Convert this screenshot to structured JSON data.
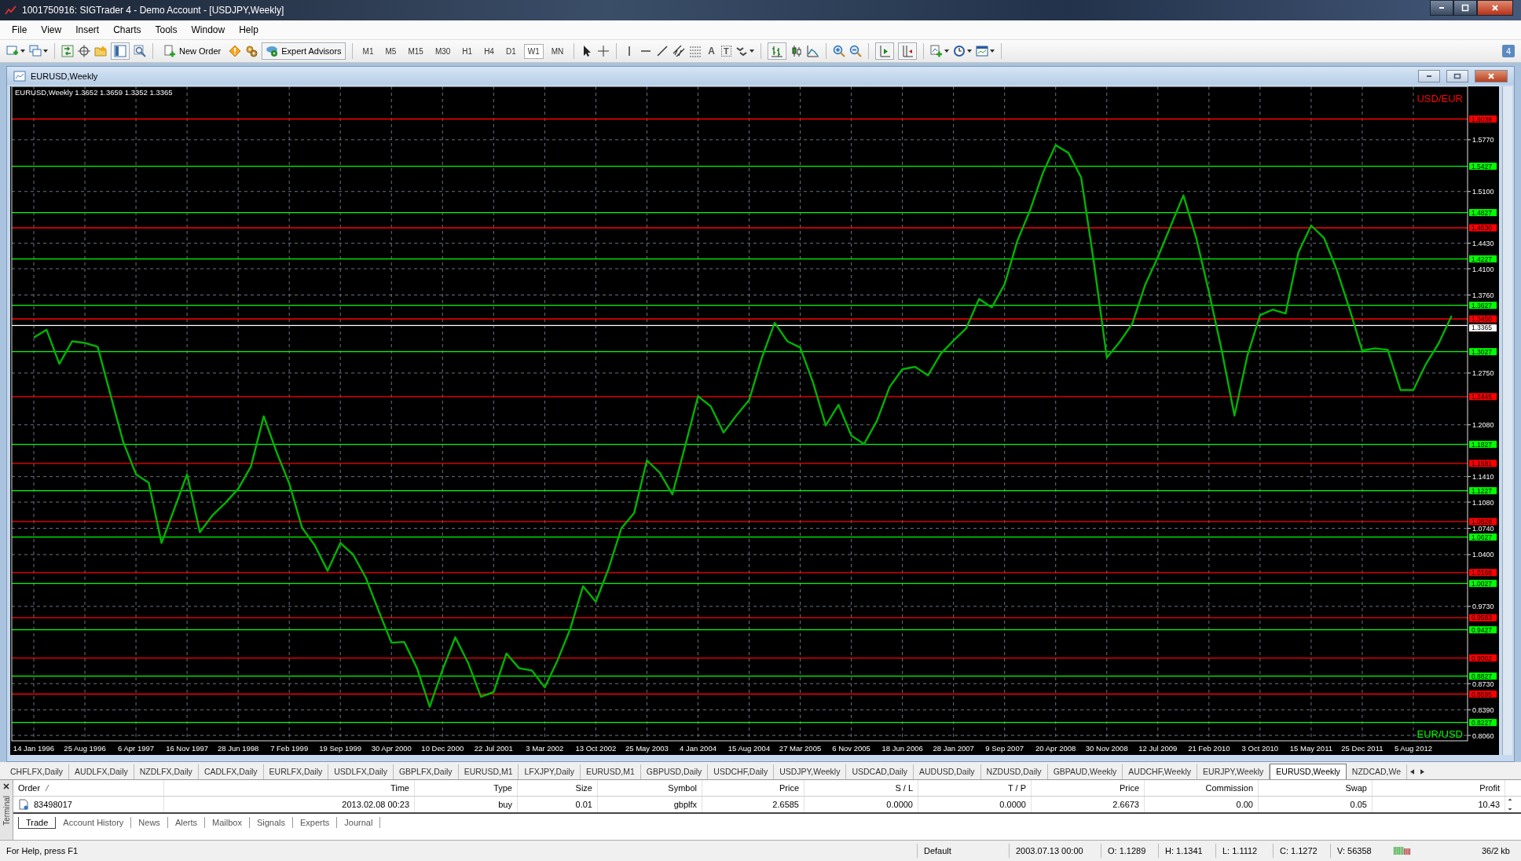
{
  "window": {
    "title": "1001750916: SIGTrader 4 - Demo Account - [USDJPY,Weekly]"
  },
  "menu": [
    "File",
    "View",
    "Insert",
    "Charts",
    "Tools",
    "Window",
    "Help"
  ],
  "toolbar": {
    "buttons": [
      {
        "label": "New Order",
        "pressed": false
      },
      {
        "label": "Expert Advisors",
        "pressed": true
      }
    ],
    "timeframes": [
      {
        "label": "M1",
        "selected": false
      },
      {
        "label": "M5",
        "selected": false
      },
      {
        "label": "M15",
        "selected": false
      },
      {
        "label": "M30",
        "selected": false
      },
      {
        "label": "H1",
        "selected": false
      },
      {
        "label": "H4",
        "selected": false
      },
      {
        "label": "D1",
        "selected": false
      },
      {
        "label": "W1",
        "selected": true
      },
      {
        "label": "MN",
        "selected": false
      }
    ],
    "text_tools": [
      "A",
      "T"
    ],
    "messages_badge": "4"
  },
  "chart_window": {
    "title": "EURUSD,Weekly",
    "chart_data": {
      "type": "line",
      "title": "EURUSD,Weekly  1.3652 1.3659 1.3352 1.3365",
      "categories": [
        "14 Jan 1996",
        null,
        null,
        null,
        "25 Aug 1996",
        null,
        null,
        null,
        "6 Apr 1997",
        null,
        null,
        null,
        "16 Nov 1997",
        null,
        null,
        null,
        "28 Jun 1998",
        null,
        null,
        null,
        "7 Feb 1999",
        null,
        null,
        null,
        "19 Sep 1999",
        null,
        null,
        null,
        "30 Apr 2000",
        null,
        null,
        null,
        "10 Dec 2000",
        null,
        null,
        null,
        "22 Jul 2001",
        null,
        null,
        null,
        "3 Mar 2002",
        null,
        null,
        null,
        "13 Oct 2002",
        null,
        null,
        null,
        "25 May 2003",
        null,
        null,
        null,
        "4 Jan 2004",
        null,
        null,
        null,
        "15 Aug 2004",
        null,
        null,
        null,
        "27 Mar 2005",
        null,
        null,
        null,
        "6 Nov 2005",
        null,
        null,
        null,
        "18 Jun 2006",
        null,
        null,
        null,
        "28 Jan 2007",
        null,
        null,
        null,
        "9 Sep 2007",
        null,
        null,
        null,
        "20 Apr 2008",
        null,
        null,
        null,
        "30 Nov 2008",
        null,
        null,
        null,
        "12 Jul 2009",
        null,
        null,
        null,
        "21 Feb 2010",
        null,
        null,
        null,
        "3 Oct 2010",
        null,
        null,
        null,
        "15 May 2011",
        null,
        null,
        null,
        "25 Dec 2011",
        null,
        null,
        null,
        "5 Aug 2012",
        null,
        null,
        null
      ],
      "series": [
        {
          "color": "#00b400",
          "values": [
            1.321,
            1.331,
            1.287,
            1.316,
            1.314,
            1.309,
            1.247,
            1.186,
            1.144,
            1.133,
            1.055,
            1.099,
            1.144,
            1.069,
            1.091,
            1.107,
            1.125,
            1.154,
            1.219,
            1.173,
            1.132,
            1.075,
            1.052,
            1.019,
            1.055,
            1.04,
            1.01,
            0.967,
            0.926,
            0.927,
            0.893,
            0.843,
            0.891,
            0.933,
            0.9,
            0.856,
            0.862,
            0.912,
            0.893,
            0.89,
            0.868,
            0.903,
            0.944,
            0.999,
            0.979,
            1.022,
            1.074,
            1.094,
            1.162,
            1.146,
            1.118,
            1.181,
            1.245,
            1.232,
            1.198,
            1.22,
            1.24,
            1.295,
            1.34,
            1.316,
            1.308,
            1.263,
            1.207,
            1.234,
            1.194,
            1.183,
            1.213,
            1.257,
            1.28,
            1.283,
            1.272,
            1.3,
            1.317,
            1.333,
            1.371,
            1.36,
            1.39,
            1.446,
            1.486,
            1.534,
            1.57,
            1.56,
            1.528,
            1.417,
            1.295,
            1.315,
            1.339,
            1.389,
            1.425,
            1.465,
            1.505,
            1.45,
            1.38,
            1.304,
            1.22,
            1.297,
            1.35,
            1.357,
            1.352,
            1.431,
            1.466,
            1.45,
            1.409,
            1.358,
            1.304,
            1.307,
            1.305,
            1.253,
            1.253,
            1.287,
            1.314,
            1.349
          ]
        }
      ],
      "ylim": [
        0.799,
        1.646
      ],
      "grid": true,
      "yticks": [
        {
          "value": 1.577,
          "label": "1.5770"
        },
        {
          "value": 1.51,
          "label": "1.5100"
        },
        {
          "value": 1.443,
          "label": "1.4430"
        },
        {
          "value": 1.41,
          "label": "1.4100"
        },
        {
          "value": 1.376,
          "label": "1.3760"
        },
        {
          "value": 1.275,
          "label": "1.2750"
        },
        {
          "value": 1.208,
          "label": "1.2080"
        },
        {
          "value": 1.141,
          "label": "1.1410"
        },
        {
          "value": 1.108,
          "label": "1.1080"
        },
        {
          "value": 1.074,
          "label": "1.0740"
        },
        {
          "value": 1.04,
          "label": "1.0400"
        },
        {
          "value": 0.973,
          "label": "0.9730"
        },
        {
          "value": 0.873,
          "label": "0.8730"
        },
        {
          "value": 0.839,
          "label": "0.8390"
        },
        {
          "value": 0.806,
          "label": "0.8060"
        }
      ],
      "ref_lines": [
        {
          "axis": "y",
          "value": 1.6038,
          "label": "1.6038",
          "color": "#ff0000"
        },
        {
          "axis": "y",
          "value": 1.5427,
          "label": "1.5427",
          "color": "#00ff00"
        },
        {
          "axis": "y",
          "value": 1.4827,
          "label": "1.4827",
          "color": "#00ff00"
        },
        {
          "axis": "y",
          "value": 1.463,
          "label": "1.4630",
          "color": "#ff0000"
        },
        {
          "axis": "y",
          "value": 1.4227,
          "label": "1.4227",
          "color": "#00ff00"
        },
        {
          "axis": "y",
          "value": 1.3627,
          "label": "1.3627",
          "color": "#00ff00"
        },
        {
          "axis": "y",
          "value": 1.345,
          "label": "1.3450",
          "color": "#ff0000"
        },
        {
          "axis": "y",
          "value": 1.3365,
          "label": "1.3365",
          "color": "#ffffff"
        },
        {
          "axis": "y",
          "value": 1.3027,
          "label": "1.3027",
          "color": "#00ff00"
        },
        {
          "axis": "y",
          "value": 1.2445,
          "label": "1.2445",
          "color": "#ff0000"
        },
        {
          "axis": "y",
          "value": 1.1827,
          "label": "1.1827",
          "color": "#00ff00"
        },
        {
          "axis": "y",
          "value": 1.1581,
          "label": "1.1581",
          "color": "#ff0000"
        },
        {
          "axis": "y",
          "value": 1.1227,
          "label": "1.1227",
          "color": "#00ff00"
        },
        {
          "axis": "y",
          "value": 1.0828,
          "label": "1.0828",
          "color": "#ff0000"
        },
        {
          "axis": "y",
          "value": 1.0627,
          "label": "1.0627",
          "color": "#00ff00"
        },
        {
          "axis": "y",
          "value": 1.0168,
          "label": "1.0168",
          "color": "#ff0000"
        },
        {
          "axis": "y",
          "value": 1.0027,
          "label": "1.0027",
          "color": "#00ff00"
        },
        {
          "axis": "y",
          "value": 0.9583,
          "label": "0.9583",
          "color": "#ff0000"
        },
        {
          "axis": "y",
          "value": 0.9427,
          "label": "0.9427",
          "color": "#00ff00"
        },
        {
          "axis": "y",
          "value": 0.9062,
          "label": "0.9062",
          "color": "#ff0000"
        },
        {
          "axis": "y",
          "value": 0.8827,
          "label": "0.8827",
          "color": "#00ff00"
        },
        {
          "axis": "y",
          "value": 0.8595,
          "label": "0.8595",
          "color": "#ff0000"
        },
        {
          "axis": "y",
          "value": 0.8227,
          "label": "0.8227",
          "color": "#00ff00"
        }
      ]
    },
    "captions": [
      {
        "text": "USD/EUR",
        "color": "#ff0000"
      },
      {
        "text": "EUR/USD",
        "color": "#00ff00"
      }
    ]
  },
  "symbol_tabs": [
    {
      "label": "CHFLFX,Daily",
      "selected": false
    },
    {
      "label": "AUDLFX,Daily",
      "selected": false
    },
    {
      "label": "NZDLFX,Daily",
      "selected": false
    },
    {
      "label": "CADLFX,Daily",
      "selected": false
    },
    {
      "label": "EURLFX,Daily",
      "selected": false
    },
    {
      "label": "USDLFX,Daily",
      "selected": false
    },
    {
      "label": "GBPLFX,Daily",
      "selected": false
    },
    {
      "label": "EURUSD,M1",
      "selected": false
    },
    {
      "label": "LFXJPY,Daily",
      "selected": false
    },
    {
      "label": "EURUSD,M1",
      "selected": false
    },
    {
      "label": "GBPUSD,Daily",
      "selected": false
    },
    {
      "label": "USDCHF,Daily",
      "selected": false
    },
    {
      "label": "USDJPY,Weekly",
      "selected": false
    },
    {
      "label": "USDCAD,Daily",
      "selected": false
    },
    {
      "label": "AUDUSD,Daily",
      "selected": false
    },
    {
      "label": "NZDUSD,Daily",
      "selected": false
    },
    {
      "label": "GBPAUD,Weekly",
      "selected": false
    },
    {
      "label": "AUDCHF,Weekly",
      "selected": false
    },
    {
      "label": "EURJPY,Weekly",
      "selected": false
    },
    {
      "label": "EURUSD,Weekly",
      "selected": true
    },
    {
      "label": "NZDCAD,We",
      "selected": false
    }
  ],
  "terminal": {
    "title": "Terminal",
    "columns": [
      {
        "label": "Order",
        "sorted": true
      },
      {
        "label": "Time",
        "sorted": false
      },
      {
        "label": "Type",
        "sorted": false
      },
      {
        "label": "Size",
        "sorted": false
      },
      {
        "label": "Symbol",
        "sorted": false
      },
      {
        "label": "Price",
        "sorted": false
      },
      {
        "label": "S / L",
        "sorted": false
      },
      {
        "label": "T / P",
        "sorted": false
      },
      {
        "label": "Price",
        "sorted": false
      },
      {
        "label": "Commission",
        "sorted": false
      },
      {
        "label": "Swap",
        "sorted": false
      },
      {
        "label": "Profit",
        "sorted": false
      }
    ],
    "rows": [
      {
        "cells": [
          "83498017",
          "2013.02.08 00:23",
          "buy",
          "0.01",
          "gbplfx",
          "2.6585",
          "0.0000",
          "0.0000",
          "2.6673",
          "0.00",
          "0.05",
          "10.43"
        ]
      }
    ],
    "tabs": [
      {
        "label": "Trade",
        "selected": true
      },
      {
        "label": "Account History",
        "selected": false
      },
      {
        "label": "News",
        "selected": false
      },
      {
        "label": "Alerts",
        "selected": false
      },
      {
        "label": "Mailbox",
        "selected": false
      },
      {
        "label": "Signals",
        "selected": false
      },
      {
        "label": "Experts",
        "selected": false
      },
      {
        "label": "Journal",
        "selected": false
      }
    ]
  },
  "status_bar": {
    "help": "For Help, press F1",
    "profile": "Default",
    "bar_info": [
      "2003.07.13 00:00",
      "O: 1.1289",
      "H: 1.1341",
      "L: 1.1112",
      "C: 1.1272",
      "V: 56358"
    ],
    "traffic": "36/2 kb"
  }
}
